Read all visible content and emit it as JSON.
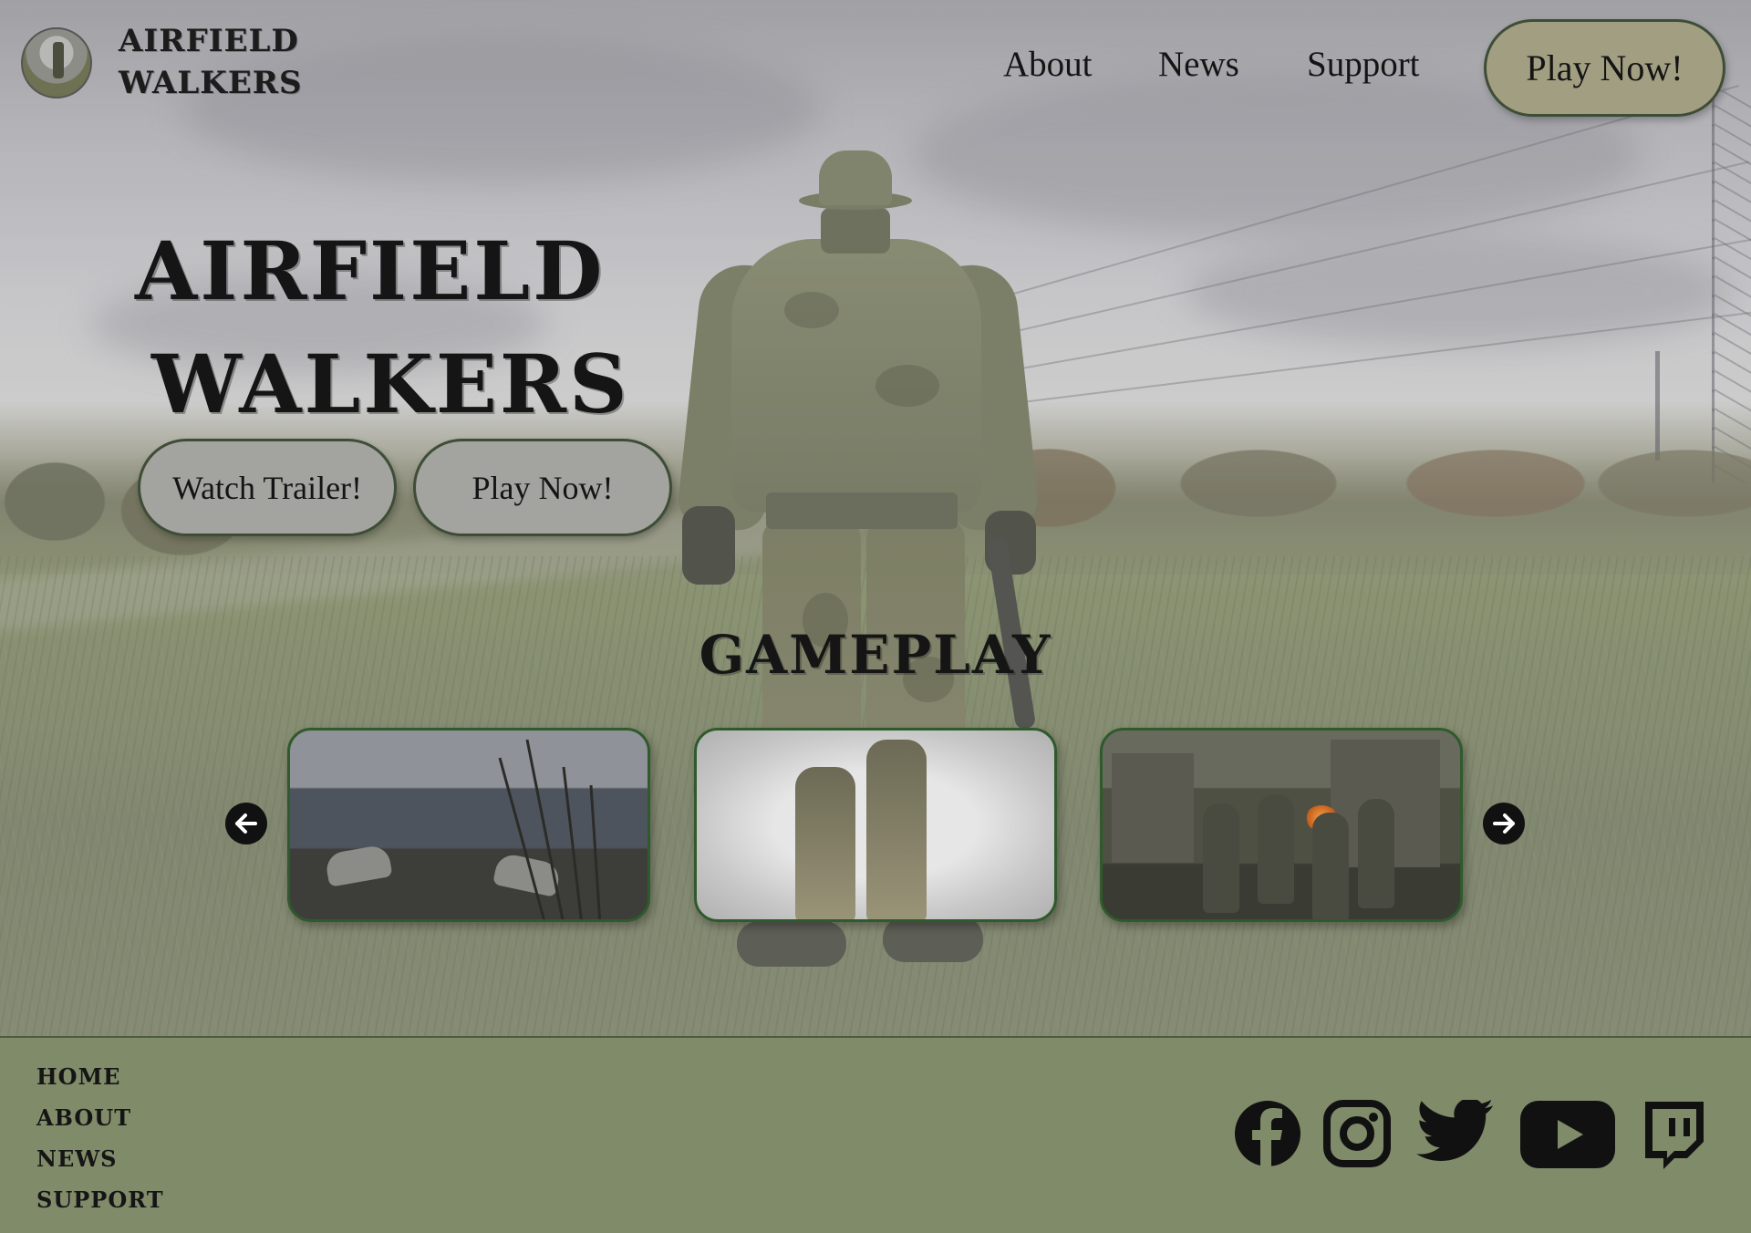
{
  "brand": {
    "name_line1": "AIRFIELD",
    "name_line2": "WALKERS",
    "logo_icon": "soldier-badge-icon"
  },
  "nav": {
    "items": [
      {
        "label": "About"
      },
      {
        "label": "News"
      },
      {
        "label": "Support"
      }
    ],
    "cta_label": "Play Now!"
  },
  "hero": {
    "title_line1": "AIRFIELD",
    "title_line2": "WALKERS",
    "trailer_label": "Watch Trailer!",
    "play_label": "Play Now!"
  },
  "gameplay": {
    "title": "GAMEPLAY",
    "prev_icon": "arrow-left-icon",
    "next_icon": "arrow-right-icon"
  },
  "footer": {
    "links": [
      {
        "label": "HOME"
      },
      {
        "label": "ABOUT"
      },
      {
        "label": "NEWS"
      },
      {
        "label": "SUPPORT"
      }
    ],
    "social_icons": [
      "facebook-icon",
      "instagram-icon",
      "twitter-icon",
      "youtube-icon",
      "twitch-icon"
    ]
  },
  "colors": {
    "header_cta_bg": "#a29e82",
    "hero_button_bg": "#a3a3a0",
    "button_border": "#3e4e36",
    "card_border": "#2f5a2c",
    "footer_bg": "#808b6a",
    "text": "#151515"
  }
}
